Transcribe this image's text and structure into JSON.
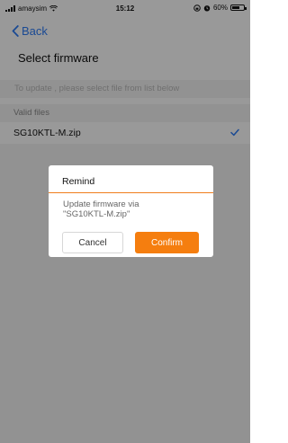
{
  "status_bar": {
    "carrier": "amaysim",
    "time": "15:12",
    "battery": "60%"
  },
  "nav": {
    "back_label": "Back",
    "title": "Select firmware"
  },
  "hint": "To update , please select file from list below",
  "section": {
    "header": "Valid files",
    "files": [
      {
        "name": "SG10KTL-M.zip",
        "selected": true
      }
    ]
  },
  "dialog": {
    "title": "Remind",
    "message_line1": "Update firmware via",
    "message_line2": "\"SG10KTL-M.zip\"",
    "cancel_label": "Cancel",
    "confirm_label": "Confirm"
  },
  "colors": {
    "accent_blue": "#2e7cf6",
    "accent_orange": "#f57e0f"
  }
}
